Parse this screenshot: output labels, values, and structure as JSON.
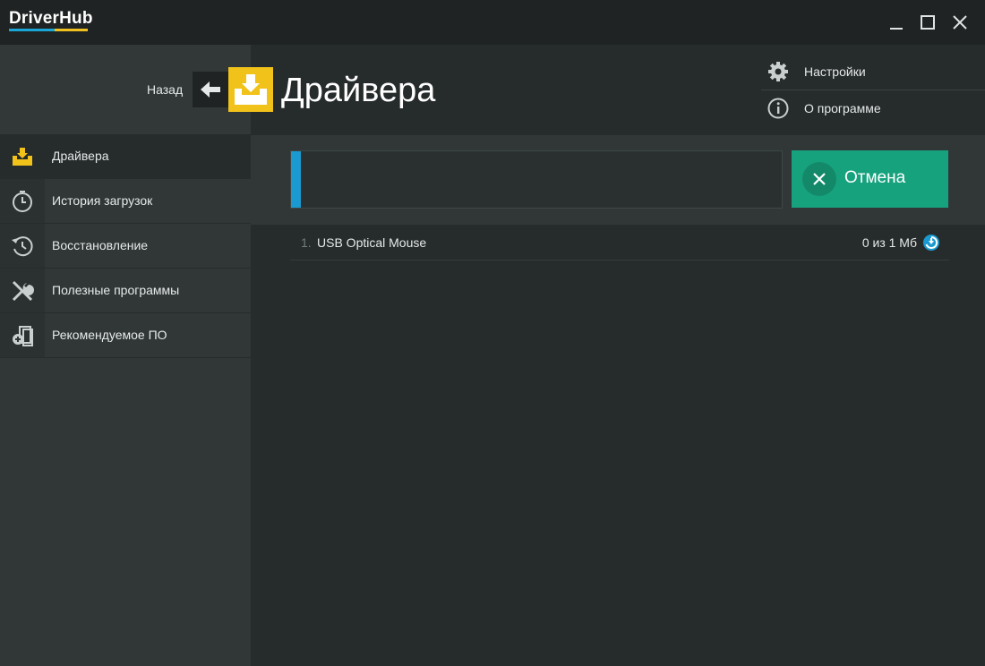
{
  "app": {
    "title": "DriverHub"
  },
  "colors": {
    "accent_yellow": "#f1c21a",
    "accent_blue": "#1a9ad0",
    "cancel_green": "#17a27e"
  },
  "header": {
    "back_label": "Назад",
    "page_title": "Драйвера",
    "page_icon": "driver-download-icon"
  },
  "top_menu": [
    {
      "label": "Настройки",
      "icon": "gear-icon"
    },
    {
      "label": "О программе",
      "icon": "info-icon"
    }
  ],
  "sidebar": {
    "items": [
      {
        "label": "Драйвера",
        "icon": "driver-download-icon",
        "active": true
      },
      {
        "label": "История загрузок",
        "icon": "timer-icon",
        "active": false
      },
      {
        "label": "Восстановление",
        "icon": "history-restore-icon",
        "active": false
      },
      {
        "label": "Полезные программы",
        "icon": "tools-icon",
        "active": false
      },
      {
        "label": "Рекомендуемое ПО",
        "icon": "recommended-software-icon",
        "active": false
      }
    ]
  },
  "download": {
    "progress_percent": 2,
    "cancel_label": "Отмена",
    "items": [
      {
        "index": "1.",
        "name": "USB Optical Mouse",
        "size": "0 из 1 Мб",
        "status_icon": "download-status-icon"
      }
    ]
  }
}
